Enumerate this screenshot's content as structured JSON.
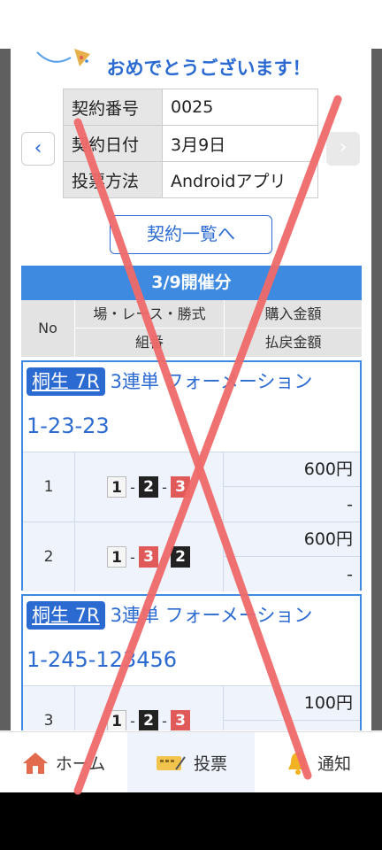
{
  "header": {
    "message": "おめでとうございます！"
  },
  "contract": {
    "rows": [
      {
        "key": "契約番号",
        "value": "0025"
      },
      {
        "key": "契約日付",
        "value": "3月9日"
      },
      {
        "key": "投票方法",
        "value": "Androidアプリ"
      }
    ],
    "list_button": "契約一覧へ"
  },
  "section": {
    "title": "3/9開催分",
    "columns": {
      "no": "No",
      "place_race_type": "場・レース・勝式",
      "purchase": "購入金額",
      "combo": "組番",
      "payout": "払戻金額"
    }
  },
  "bets": [
    {
      "venue": "桐生 7R",
      "type": "3連単 フォーメーション",
      "combo": "1-23-23",
      "rows": [
        {
          "no": "1",
          "boats": [
            "1",
            "2",
            "3"
          ],
          "amount": "600円",
          "payout": "-"
        },
        {
          "no": "2",
          "boats": [
            "1",
            "3",
            "2"
          ],
          "amount": "600円",
          "payout": "-"
        }
      ]
    },
    {
      "venue": "桐生 7R",
      "type": "3連単 フォーメーション",
      "combo": "1-245-123456",
      "rows": [
        {
          "no": "3",
          "boats": [
            "1",
            "2",
            "3"
          ],
          "amount": "100円",
          "payout": ""
        }
      ]
    }
  ],
  "bottom_nav": [
    {
      "label": "ホーム",
      "icon": "home-icon"
    },
    {
      "label": "投票",
      "icon": "ticket-icon"
    },
    {
      "label": "通知",
      "icon": "bell-icon"
    }
  ],
  "colors": {
    "accent": "#2b6bd1",
    "header_bar": "#3d8ae0",
    "cross": "#f06a6a"
  }
}
